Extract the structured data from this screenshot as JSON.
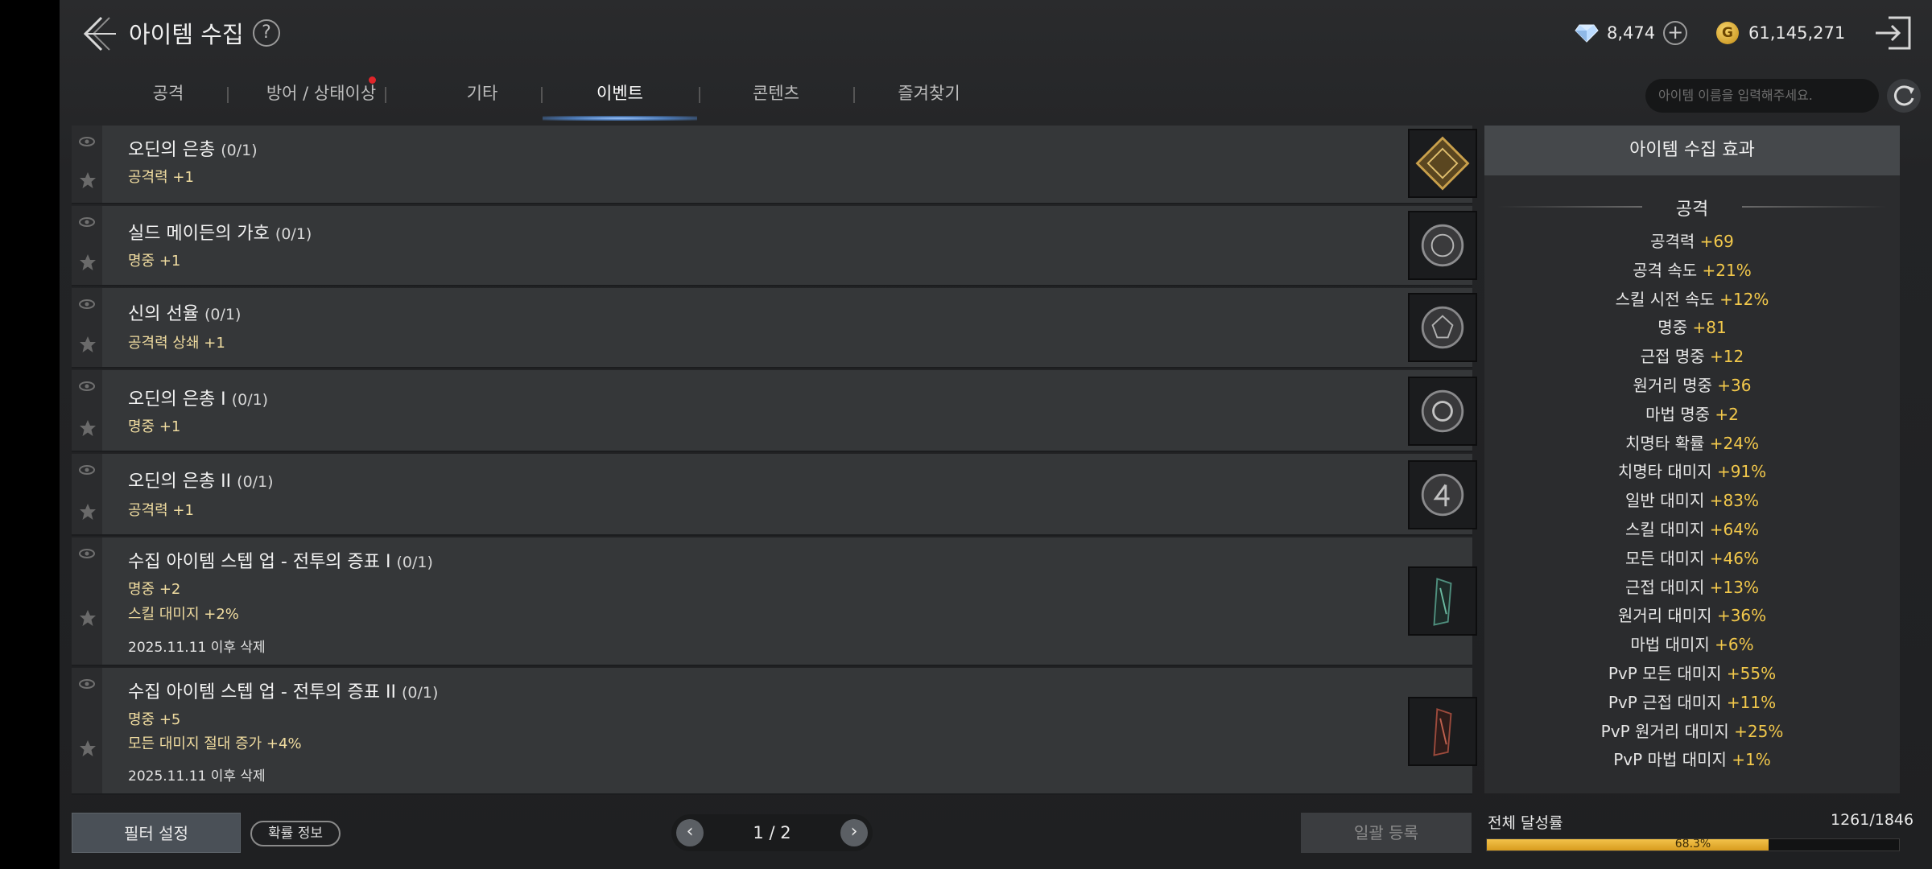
{
  "header": {
    "title": "아이템 수집",
    "help": "?",
    "diamonds": "8,474",
    "gold": "61,145,271",
    "gold_glyph": "G",
    "plus": "+"
  },
  "tabs": [
    {
      "label": "공격"
    },
    {
      "label": "방어 / 상태이상"
    },
    {
      "label": "기타"
    },
    {
      "label": "이벤트"
    },
    {
      "label": "콘텐츠"
    },
    {
      "label": "즐겨찾기"
    }
  ],
  "search": {
    "placeholder": "아이템 이름을 입력해주세요."
  },
  "items": [
    {
      "name": "오딘의 은총",
      "count": "(0/1)",
      "stats": [
        "공격력 +1"
      ],
      "expiry": ""
    },
    {
      "name": "실드 메이든의 가호",
      "count": "(0/1)",
      "stats": [
        "명중 +1"
      ],
      "expiry": ""
    },
    {
      "name": "신의 선율",
      "count": "(0/1)",
      "stats": [
        "공격력 상쇄 +1"
      ],
      "expiry": ""
    },
    {
      "name": "오딘의 은총 I",
      "count": "(0/1)",
      "stats": [
        "명중 +1"
      ],
      "expiry": ""
    },
    {
      "name": "오딘의 은총 II",
      "count": "(0/1)",
      "stats": [
        "공격력 +1"
      ],
      "expiry": ""
    },
    {
      "name": "수집 아이템 스텝 업 - 전투의 증표 I",
      "count": "(0/1)",
      "stats": [
        "명중 +2",
        "스킬 대미지 +2%"
      ],
      "expiry": "2025.11.11 이후 삭제"
    },
    {
      "name": "수집 아이템 스텝 업 - 전투의 증표 II",
      "count": "(0/1)",
      "stats": [
        "명중 +5",
        "모든 대미지 절대 증가 +4%"
      ],
      "expiry": "2025.11.11 이후 삭제"
    }
  ],
  "panel": {
    "title": "아이템 수집 효과",
    "section": "공격",
    "effects": [
      {
        "label": "공격력",
        "value": "+69"
      },
      {
        "label": "공격 속도",
        "value": "+21%"
      },
      {
        "label": "스킬 시전 속도",
        "value": "+12%"
      },
      {
        "label": "명중",
        "value": "+81"
      },
      {
        "label": "근접 명중",
        "value": "+12"
      },
      {
        "label": "원거리 명중",
        "value": "+36"
      },
      {
        "label": "마법 명중",
        "value": "+2"
      },
      {
        "label": "치명타 확률",
        "value": "+24%"
      },
      {
        "label": "치명타 대미지",
        "value": "+91%"
      },
      {
        "label": "일반 대미지",
        "value": "+83%"
      },
      {
        "label": "스킬 대미지",
        "value": "+64%"
      },
      {
        "label": "모든 대미지",
        "value": "+46%"
      },
      {
        "label": "근접 대미지",
        "value": "+13%"
      },
      {
        "label": "원거리 대미지",
        "value": "+36%"
      },
      {
        "label": "마법 대미지",
        "value": "+6%"
      },
      {
        "label": "PvP 모든 대미지",
        "value": "+55%"
      },
      {
        "label": "PvP 근접 대미지",
        "value": "+11%"
      },
      {
        "label": "PvP 원거리 대미지",
        "value": "+25%"
      },
      {
        "label": "PvP 마법 대미지",
        "value": "+1%"
      }
    ]
  },
  "footer": {
    "filter": "필터 설정",
    "probability": "확률 정보",
    "page": "1 / 2",
    "prev": "‹",
    "next": "›",
    "batch": "일괄 등록",
    "progress_label": "전체 달성률",
    "progress_count": "1261/1846",
    "progress_percent_text": "68.3%",
    "progress_fraction": 0.683
  },
  "colors": {
    "accent_gold": "#f2c84b",
    "tab_glow": "#9fc8ff",
    "notify_red": "#e0252a"
  }
}
